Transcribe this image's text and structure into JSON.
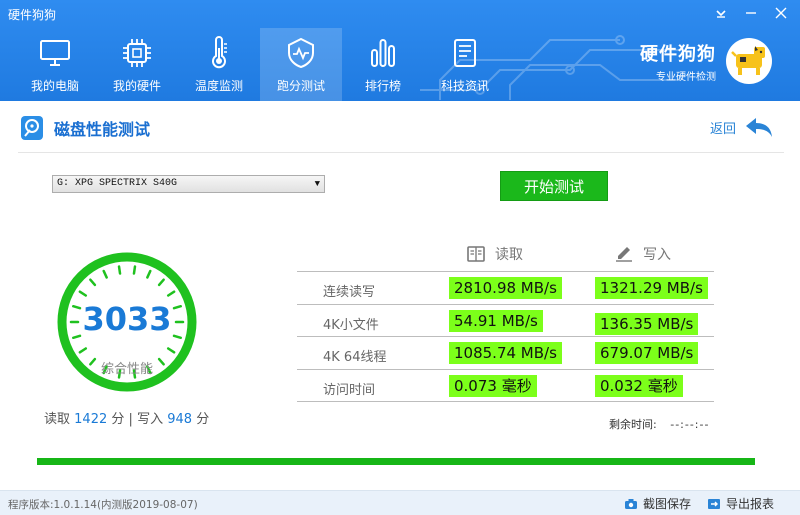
{
  "window": {
    "title": "硬件狗狗",
    "controls": [
      "menu-dropdown",
      "minimize",
      "close"
    ]
  },
  "nav": {
    "items": [
      {
        "label": "我的电脑",
        "icon": "monitor-icon"
      },
      {
        "label": "我的硬件",
        "icon": "chip-icon"
      },
      {
        "label": "温度监测",
        "icon": "thermometer-icon"
      },
      {
        "label": "跑分测试",
        "icon": "benchmark-shield-icon",
        "active": true
      },
      {
        "label": "排行榜",
        "icon": "ranking-bars-icon"
      },
      {
        "label": "科技资讯",
        "icon": "news-doc-icon"
      }
    ]
  },
  "brand": {
    "name": "硬件狗狗",
    "subtitle": "专业硬件检测"
  },
  "section": {
    "title": "磁盘性能测试",
    "back": "返回"
  },
  "drive": {
    "selected": "G: XPG SPECTRIX S40G"
  },
  "start_button": "开始测试",
  "gauge": {
    "score": "3033",
    "label": "综合性能"
  },
  "score_summary": {
    "read_label": "读取",
    "read_value": "1422",
    "unit": "分",
    "sep": "|",
    "write_label": "写入",
    "write_value": "948"
  },
  "table": {
    "read_header": "读取",
    "write_header": "写入",
    "rows": [
      {
        "label": "连续读写",
        "read": "2810.98 MB/s",
        "write": "1321.29 MB/s"
      },
      {
        "label": "4K小文件",
        "read": "54.91 MB/s",
        "write": "136.35 MB/s"
      },
      {
        "label": "4K 64线程",
        "read": "1085.74 MB/s",
        "write": "679.07 MB/s"
      },
      {
        "label": "访问时间",
        "read": "0.073 毫秒",
        "write": "0.032 毫秒"
      }
    ]
  },
  "remaining": {
    "label": "剩余时间:",
    "value": "--:--:--"
  },
  "progress": 1.0,
  "footer": {
    "version": "程序版本:1.0.1.14(内测版2019-08-07)",
    "screenshot": "截图保存",
    "export": "导出报表"
  },
  "colors": {
    "header": "#2f8cf0",
    "accent": "#1a7ad6",
    "highlight": "#7cff1a",
    "green": "#1bb81b"
  }
}
